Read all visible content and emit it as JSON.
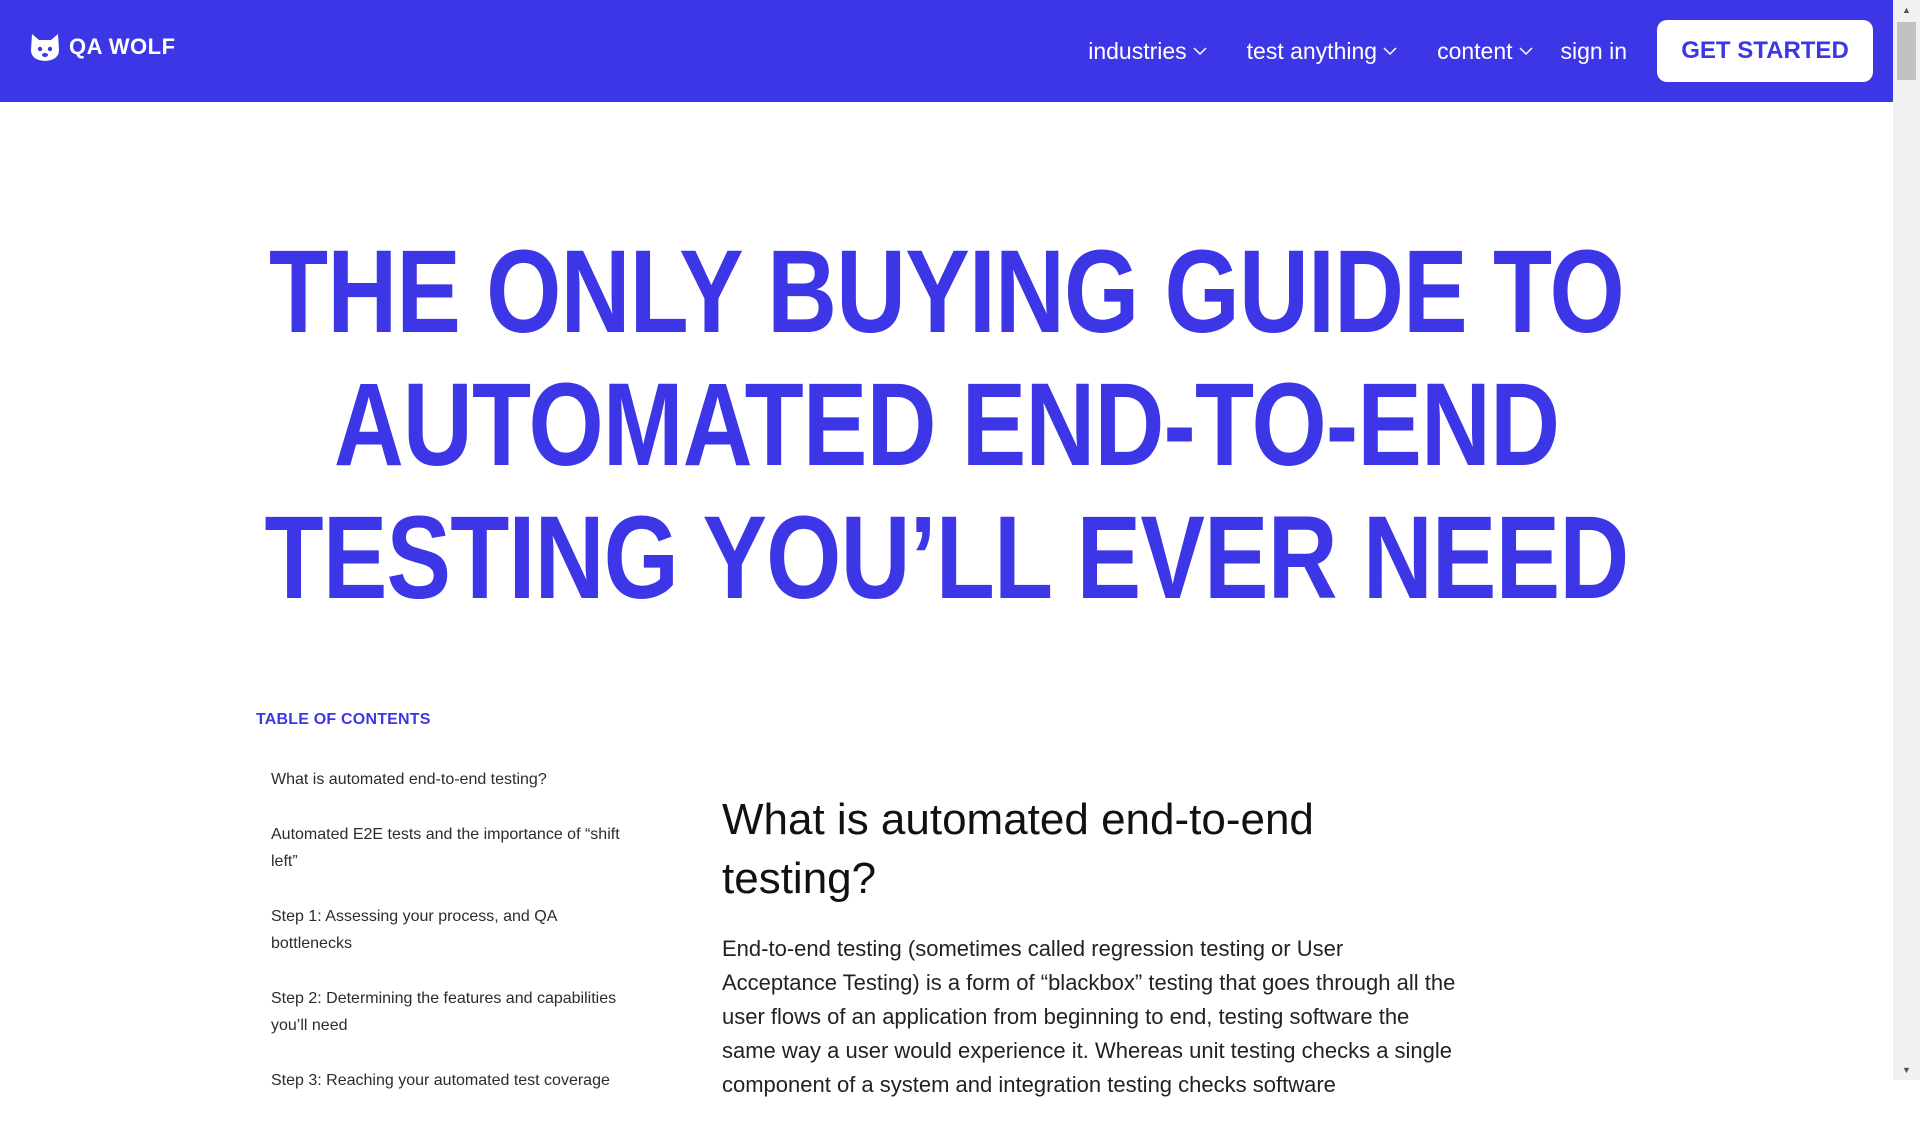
{
  "brand": {
    "name": "QA WOLF",
    "logo_icon": "wolf-paw-icon"
  },
  "nav": {
    "items": [
      {
        "label": "industries",
        "icon": "chevron-down-icon"
      },
      {
        "label": "test anything",
        "icon": "chevron-down-icon"
      },
      {
        "label": "content",
        "icon": "chevron-down-icon"
      }
    ],
    "signin_label": "sign in",
    "cta_label": "GET STARTED"
  },
  "hero": {
    "title": "THE ONLY BUYING GUIDE TO\nAUTOMATED END-TO-END\nTESTING YOU’LL EVER NEED"
  },
  "toc": {
    "title": "TABLE OF CONTENTS",
    "items": [
      "What is automated end-to-end testing?",
      "Automated E2E tests and the importance of “shift left”",
      "Step 1: Assessing your process, and QA bottlenecks",
      "Step 2: Determining the features and capabilities you’ll need",
      "Step 3: Reaching your automated test coverage"
    ]
  },
  "article": {
    "heading": "What is automated end-to-end testing?",
    "body": "End-to-end testing (sometimes called regression testing or User Acceptance Testing) is a form of “blackbox” testing that goes through all the user flows of an application from beginning to end, testing software the same way a user would experience it. Whereas unit testing checks a single component of a system and integration testing checks software"
  },
  "colors": {
    "brand": "#3d36e6",
    "nav_text": "#ffffff",
    "cta_bg": "#ffffff"
  }
}
